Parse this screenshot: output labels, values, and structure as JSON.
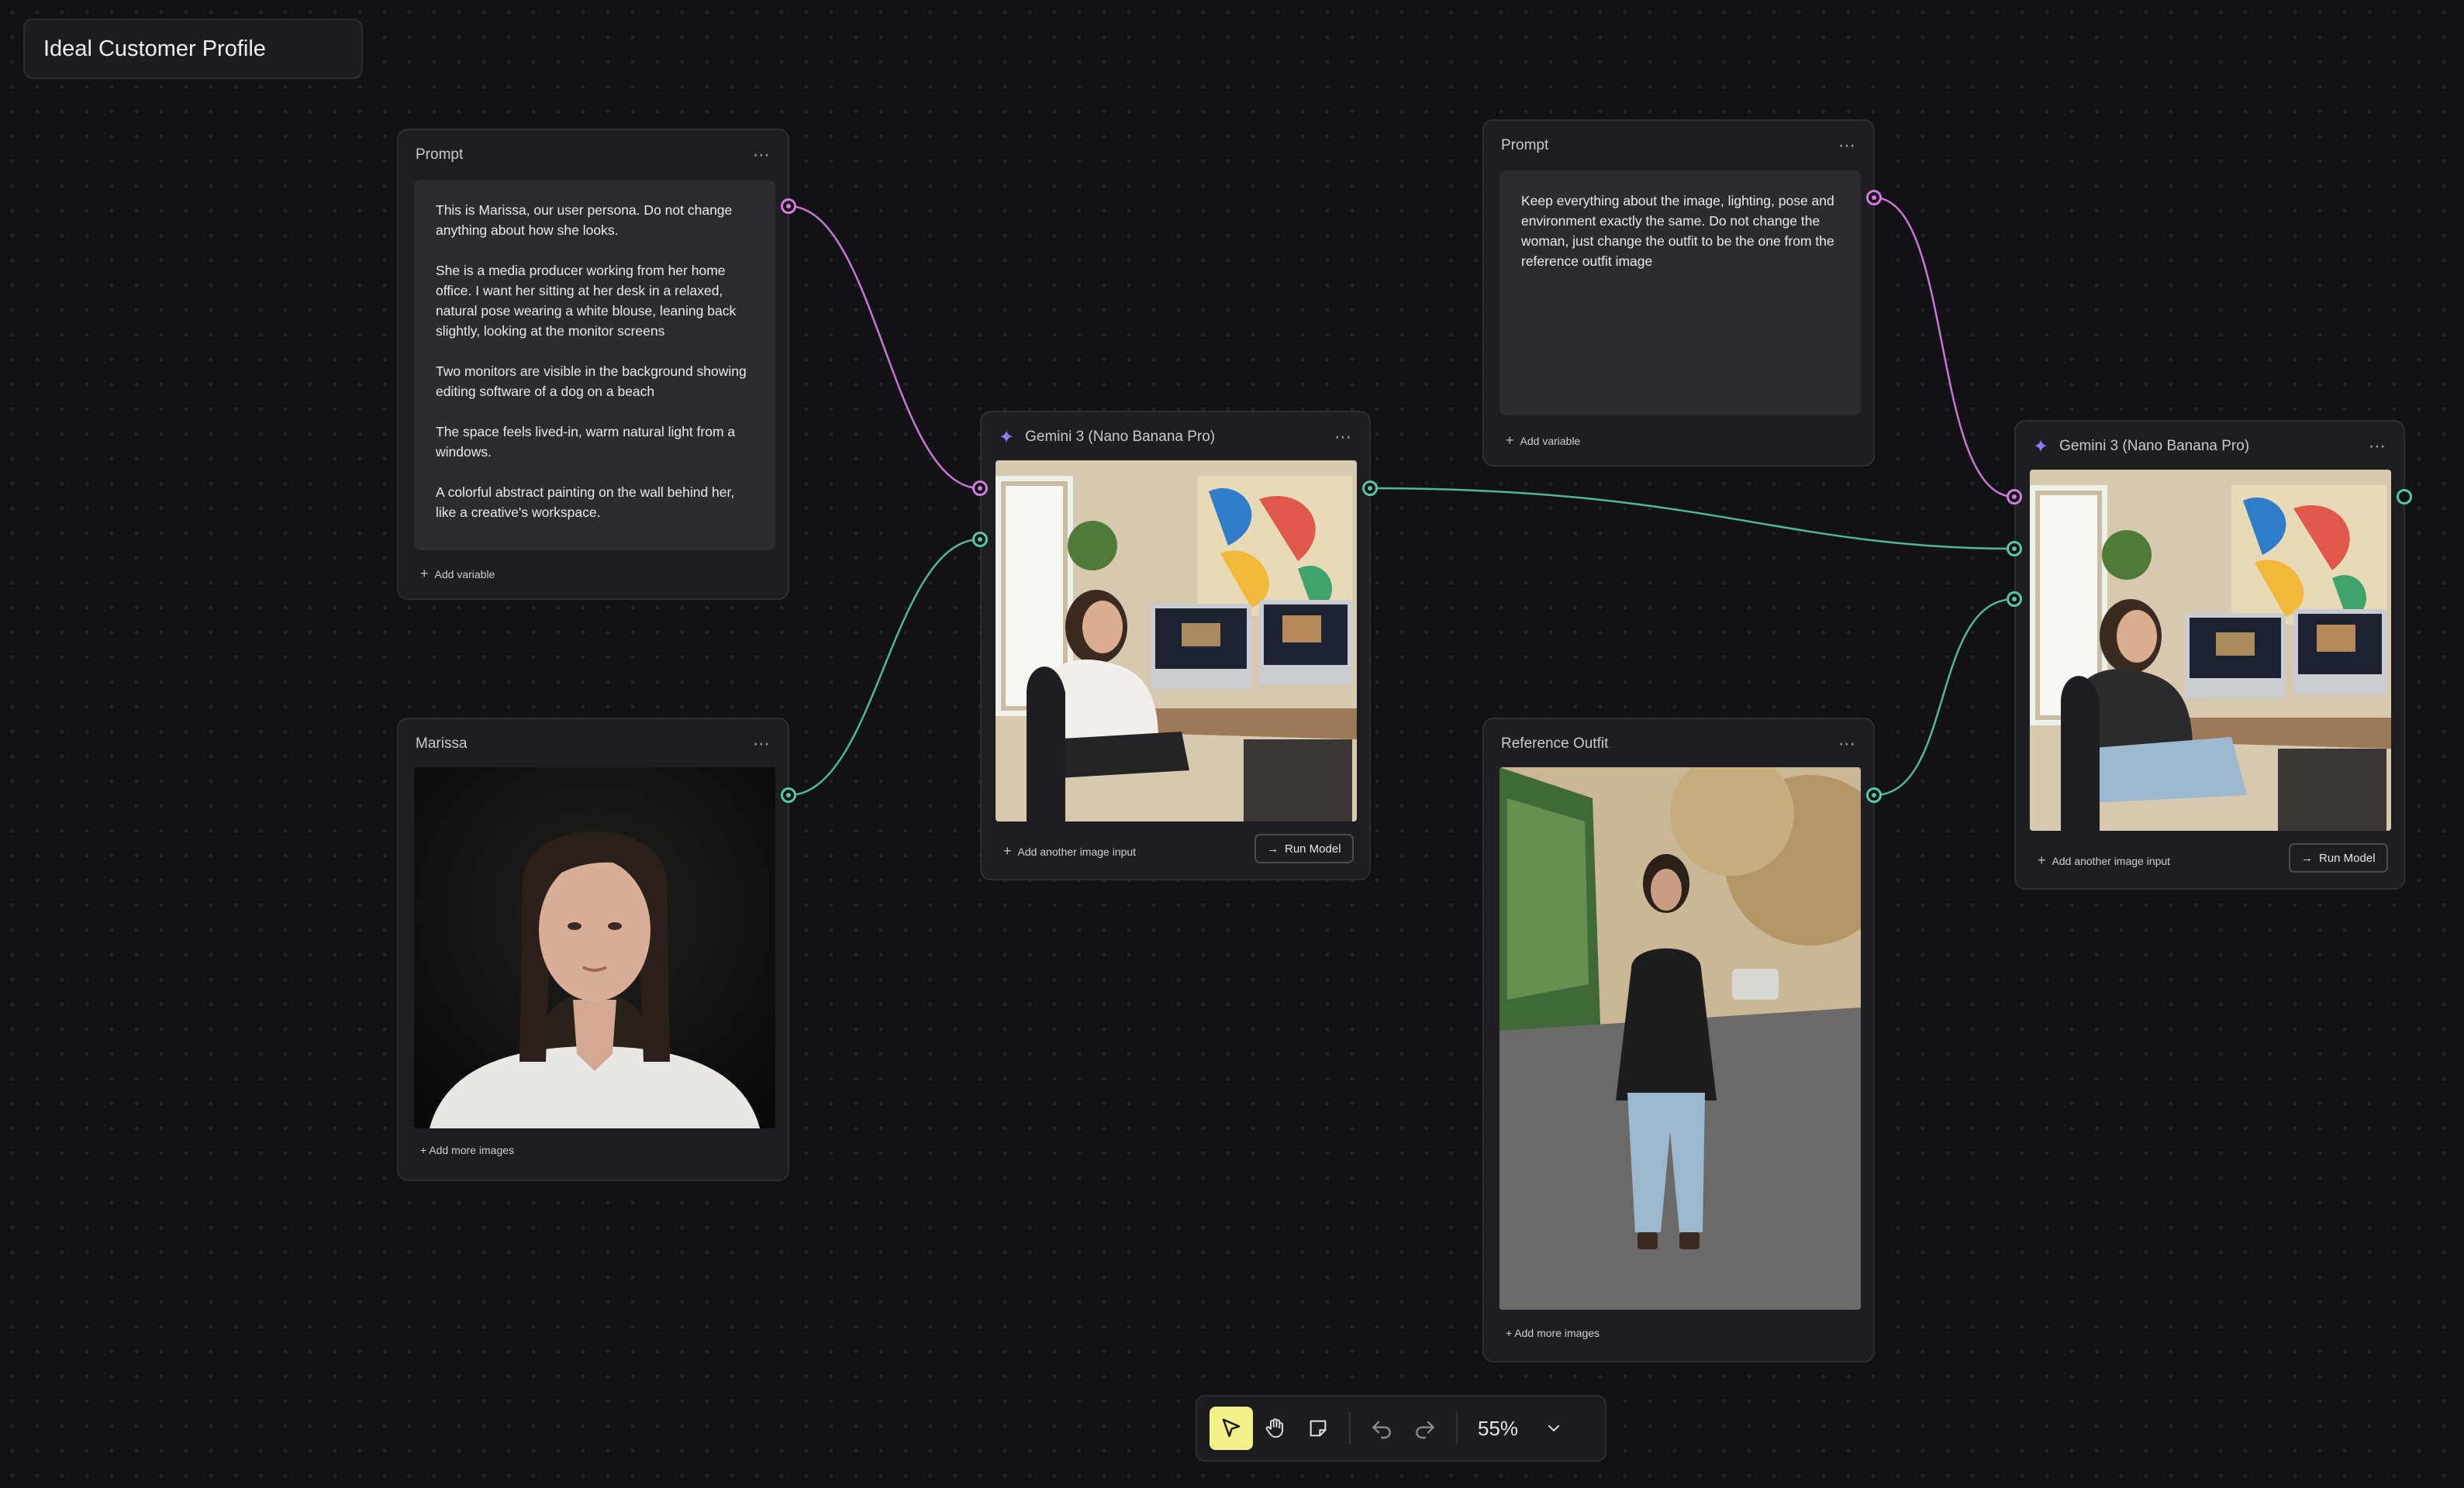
{
  "board": {
    "title": "Ideal Customer Profile"
  },
  "nodes": {
    "prompt1": {
      "title": "Prompt",
      "paragraphs": [
        "This is Marissa, our user persona. Do not change anything about how she looks.",
        "She is a media producer working from her home office. I want her sitting at her desk in a relaxed, natural pose wearing a white blouse, leaning back slightly, looking at the monitor screens",
        "Two monitors are visible in the background showing editing software of a dog on a beach",
        "The space feels lived-in,  warm natural light from a windows.",
        "A colorful abstract painting on the wall behind her, like a creative's workspace."
      ],
      "add_variable": "Add variable"
    },
    "marissa": {
      "title": "Marissa",
      "add_images": "+ Add more images"
    },
    "gemini1": {
      "title": "Gemini 3 (Nano Banana Pro)",
      "add_input": "Add another image input",
      "run": "Run Model"
    },
    "prompt2": {
      "title": "Prompt",
      "paragraphs": [
        "Keep everything about the image, lighting, pose and environment exactly the same. Do not change the woman, just change the  outfit to be the one from the reference outfit image"
      ],
      "add_variable": "Add variable"
    },
    "outfit": {
      "title": "Reference Outfit",
      "add_images": "+ Add more images"
    },
    "gemini2": {
      "title": "Gemini 3 (Nano Banana Pro)",
      "add_input": "Add another image input",
      "run": "Run Model"
    }
  },
  "toolbar": {
    "zoom": "55%",
    "tools": [
      "select-tool",
      "hand-tool",
      "sticky-note-tool",
      "undo",
      "redo"
    ]
  },
  "colors": {
    "accent": "#f3f08a",
    "text_wire": "#d57ae3",
    "image_wire": "#56c7a8",
    "canvas": "#121216"
  }
}
